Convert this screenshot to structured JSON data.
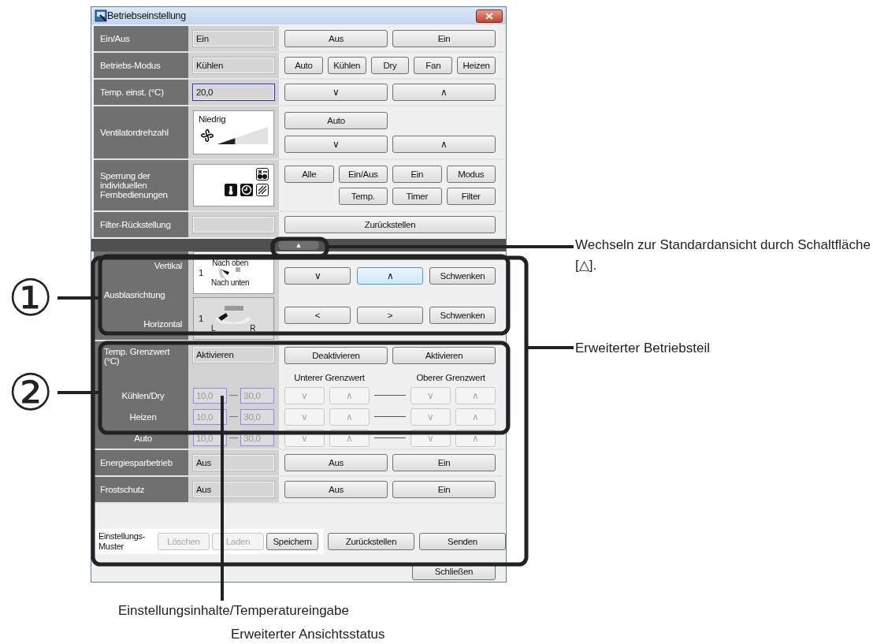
{
  "window": {
    "title": "Betriebseinstellung"
  },
  "rows": [
    {
      "kind": "simple",
      "label": "Ein/Aus",
      "value": "Ein",
      "buttons": [
        {
          "label": "Aus"
        },
        {
          "label": "Ein"
        }
      ]
    },
    {
      "kind": "simple",
      "label": "Betriebs-Modus",
      "value": "Kühlen",
      "buttons": [
        {
          "label": "Auto"
        },
        {
          "label": "Kühlen"
        },
        {
          "label": "Dry"
        },
        {
          "label": "Fan"
        },
        {
          "label": "Heizen"
        }
      ]
    },
    {
      "kind": "simple",
      "label": "Temp. einst. (°C)",
      "value": "20,0",
      "focused": true,
      "buttons": [
        {
          "label": "∨"
        },
        {
          "label": "∧"
        }
      ]
    },
    {
      "kind": "fan",
      "label": "Ventilatordrehzahl",
      "speed": "Niedrig",
      "level": 0.35,
      "buttons": [
        {
          "label": "Auto"
        },
        {
          "label": "∨"
        },
        {
          "label": "∧"
        }
      ]
    },
    {
      "kind": "lock",
      "label": "Sperrung der individuellen Fernbedienungen",
      "buttons": [
        {
          "label": "Alle"
        },
        {
          "label": "Ein/Aus"
        },
        {
          "label": "Ein"
        },
        {
          "label": "Modus"
        },
        {
          "label": "Temp."
        },
        {
          "label": "Timer"
        },
        {
          "label": "Filter"
        }
      ]
    },
    {
      "kind": "simple",
      "label": "Filter-Rückstellung",
      "buttons": [
        {
          "label": "Zurückstellen"
        }
      ]
    }
  ],
  "toggle": {
    "label": "▲"
  },
  "direction": {
    "label": "Ausblasrichtung",
    "vertical": {
      "label": "Vertikal",
      "value": "1",
      "top": "Nach oben",
      "bottom": "Nach unten",
      "buttons": [
        {
          "label": "∨",
          "focused": false
        },
        {
          "label": "∧",
          "focused": true
        },
        {
          "label": "Schwenken",
          "focused": false
        }
      ]
    },
    "horizontal": {
      "label": "Horizontal",
      "value": "1",
      "left": "L",
      "right": "R",
      "buttons": [
        {
          "label": "<",
          "focused": false
        },
        {
          "label": ">",
          "focused": false
        },
        {
          "label": "Schwenken",
          "focused": false
        }
      ]
    }
  },
  "limits": {
    "label": "Temp. Grenzwert (°C)",
    "value": "Aktivieren",
    "buttons": [
      {
        "label": "Deaktivieren"
      },
      {
        "label": "Aktivieren"
      }
    ],
    "lower_heading": "Unterer Grenzwert",
    "upper_heading": "Oberer Grenzwert",
    "disabled": true,
    "modes": [
      {
        "label": "Kühlen/Dry",
        "low": "10,0",
        "high": "30,0",
        "buttons": [
          {
            "label": "∨"
          },
          {
            "label": "∧"
          },
          {
            "label": "∨"
          },
          {
            "label": "∧"
          }
        ]
      },
      {
        "label": "Heizen",
        "low": "10,0",
        "high": "30,0",
        "buttons": [
          {
            "label": "∨"
          },
          {
            "label": "∧"
          },
          {
            "label": "∨"
          },
          {
            "label": "∧"
          }
        ]
      },
      {
        "label": "Auto",
        "low": "10,0",
        "high": "30,0",
        "buttons": [
          {
            "label": "∨"
          },
          {
            "label": "∧"
          },
          {
            "label": "∨"
          },
          {
            "label": "∧"
          }
        ]
      }
    ]
  },
  "extra_rows": [
    {
      "label": "Energiesparbetrieb",
      "value": "Aus",
      "buttons": [
        {
          "label": "Aus"
        },
        {
          "label": "Ein"
        }
      ]
    },
    {
      "label": "Frostschutz",
      "value": "Aus",
      "buttons": [
        {
          "label": "Aus"
        },
        {
          "label": "Ein"
        }
      ]
    }
  ],
  "pattern": {
    "label": "Einstellungs-Muster",
    "buttons": [
      {
        "label": "Löschen",
        "disabled": true
      },
      {
        "label": "Laden",
        "disabled": true
      },
      {
        "label": "Speichern",
        "disabled": false
      }
    ]
  },
  "footer_buttons": [
    {
      "label": "Zurückstellen"
    },
    {
      "label": "Senden"
    }
  ],
  "close_button": {
    "label": "Schließen"
  },
  "callouts": {
    "marker_1": "①",
    "marker_2": "②",
    "toggle_note": "Wechseln zur Standardansicht durch Schaltfläche [△].",
    "section_note": "Erweiterter Betriebsteil",
    "input_note": "Einstellungsinhalte/Temperatureingabe",
    "status_note": "Erweiterter Ansichtsstatus"
  }
}
